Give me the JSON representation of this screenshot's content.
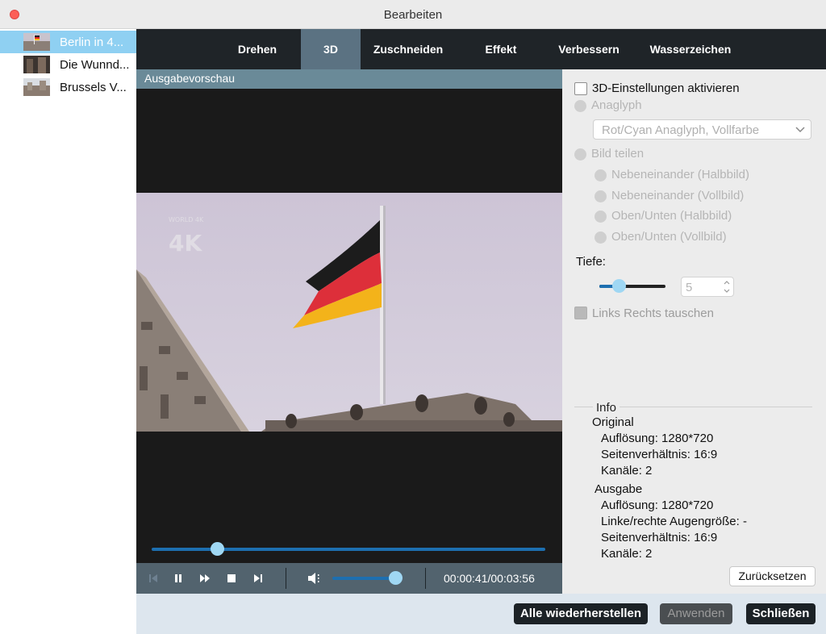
{
  "window": {
    "title": "Bearbeiten"
  },
  "sidebar": {
    "items": [
      {
        "label": "Berlin in 4...",
        "selected": true
      },
      {
        "label": "Die Wunnd...",
        "selected": false
      },
      {
        "label": "Brussels V...",
        "selected": false
      }
    ]
  },
  "tabs": [
    "Drehen",
    "3D",
    "Zuschneiden",
    "Effekt",
    "Verbessern",
    "Wasserzeichen"
  ],
  "active_tab": "3D",
  "preview": {
    "header": "Ausgabevorschau",
    "watermark": "WORLD 4K",
    "progress_fraction": 0.17,
    "volume_fraction": 0.85,
    "time": "00:00:41/00:03:56"
  },
  "settings": {
    "enable_3d_label": "3D-Einstellungen aktivieren",
    "enable_3d_checked": false,
    "anaglyph_label": "Anaglyph",
    "anaglyph_select": "Rot/Cyan Anaglyph, Vollfarbe",
    "split_label": "Bild teilen",
    "split_options": [
      "Nebeneinander (Halbbild)",
      "Nebeneinander (Vollbild)",
      "Oben/Unten (Halbbild)",
      "Oben/Unten (Vollbild)"
    ],
    "depth_label": "Tiefe:",
    "depth_value": "5",
    "swap_label": "Links Rechts tauschen"
  },
  "info": {
    "title": "Info",
    "original_title": "Original",
    "original_resolution": "Auflösung: 1280*720",
    "original_aspect": "Seitenverhältnis: 16:9",
    "original_channels": "Kanäle: 2",
    "output_title": "Ausgabe",
    "output_resolution": "Auflösung: 1280*720",
    "output_eye_size": "Linke/rechte Augengröße: -",
    "output_aspect": "Seitenverhältnis: 16:9",
    "output_channels": "Kanäle: 2"
  },
  "buttons": {
    "reset": "Zurücksetzen",
    "restore_all": "Alle wiederherstellen",
    "apply": "Anwenden",
    "close": "Schließen"
  },
  "colors": {
    "accent": "#1d6fb0",
    "knob": "#9fd7f3",
    "selection": "#8fd0f2",
    "dark_bar": "#1f2428"
  }
}
